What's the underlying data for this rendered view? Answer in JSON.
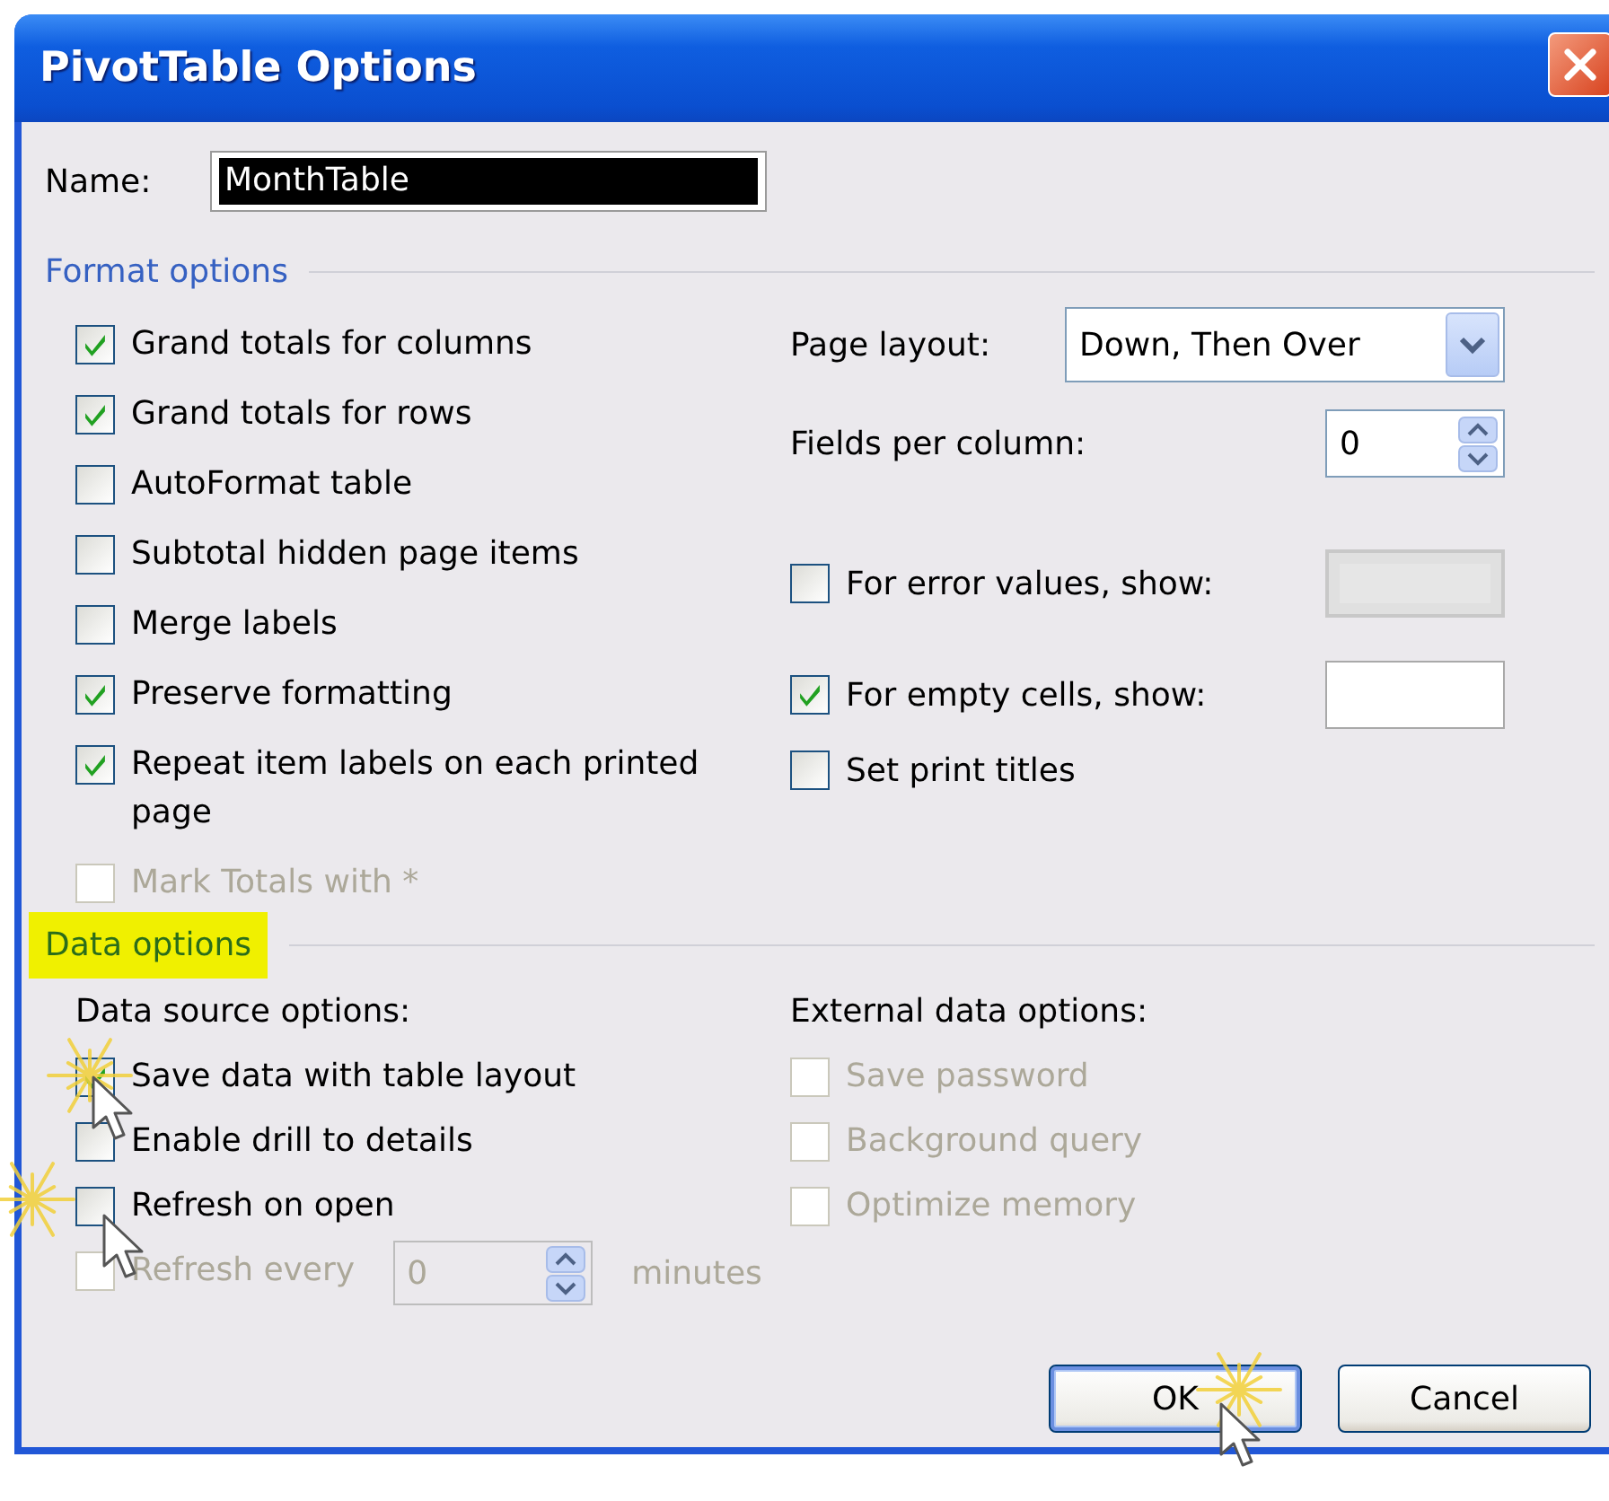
{
  "window": {
    "title": "PivotTable Options"
  },
  "name_field": {
    "label": "Name:",
    "value": "MonthTable",
    "selected": true
  },
  "format_options": {
    "title": "Format options",
    "highlighted": false,
    "left": [
      {
        "label": "Grand totals for columns",
        "checked": true,
        "disabled": false
      },
      {
        "label": "Grand totals for rows",
        "checked": true,
        "disabled": false
      },
      {
        "label": "AutoFormat table",
        "checked": false,
        "disabled": false
      },
      {
        "label": "Subtotal hidden page items",
        "checked": false,
        "disabled": false
      },
      {
        "label": "Merge labels",
        "checked": false,
        "disabled": false
      },
      {
        "label": "Preserve formatting",
        "checked": true,
        "disabled": false
      },
      {
        "label": "Repeat item labels on each printed page",
        "checked": true,
        "disabled": false
      },
      {
        "label": "Mark Totals with *",
        "checked": false,
        "disabled": true
      }
    ],
    "right": [
      {
        "kind": "select",
        "label": "Page layout:",
        "value": "Down, Then Over"
      },
      {
        "kind": "spin",
        "label": "Fields per column:",
        "value": "0"
      },
      {
        "kind": "check_field",
        "label": "For error values, show:",
        "checked": false,
        "field_disabled": true
      },
      {
        "kind": "check_field",
        "label": "For empty cells, show:",
        "checked": true,
        "field_disabled": false
      },
      {
        "kind": "check",
        "label": "Set print titles",
        "checked": false
      }
    ]
  },
  "data_options": {
    "title": "Data options",
    "highlighted": true,
    "source": {
      "title": "Data source options:",
      "items": [
        {
          "kind": "check",
          "label": "Save data with table layout",
          "checked": true,
          "disabled": false
        },
        {
          "kind": "check",
          "label": "Enable drill to details",
          "checked": false,
          "disabled": false
        },
        {
          "kind": "check",
          "label": "Refresh on open",
          "checked": false,
          "disabled": false
        },
        {
          "kind": "check_interval",
          "label": "Refresh every",
          "checked": false,
          "disabled": true,
          "value": "0",
          "unit": "minutes"
        }
      ]
    },
    "external": {
      "title": "External data options:",
      "items": [
        {
          "label": "Save password",
          "checked": false,
          "disabled": true
        },
        {
          "label": "Background query",
          "checked": false,
          "disabled": true
        },
        {
          "label": "Optimize memory",
          "checked": false,
          "disabled": true
        }
      ]
    }
  },
  "buttons": [
    {
      "label": "OK",
      "default": true
    },
    {
      "label": "Cancel",
      "default": false
    }
  ]
}
